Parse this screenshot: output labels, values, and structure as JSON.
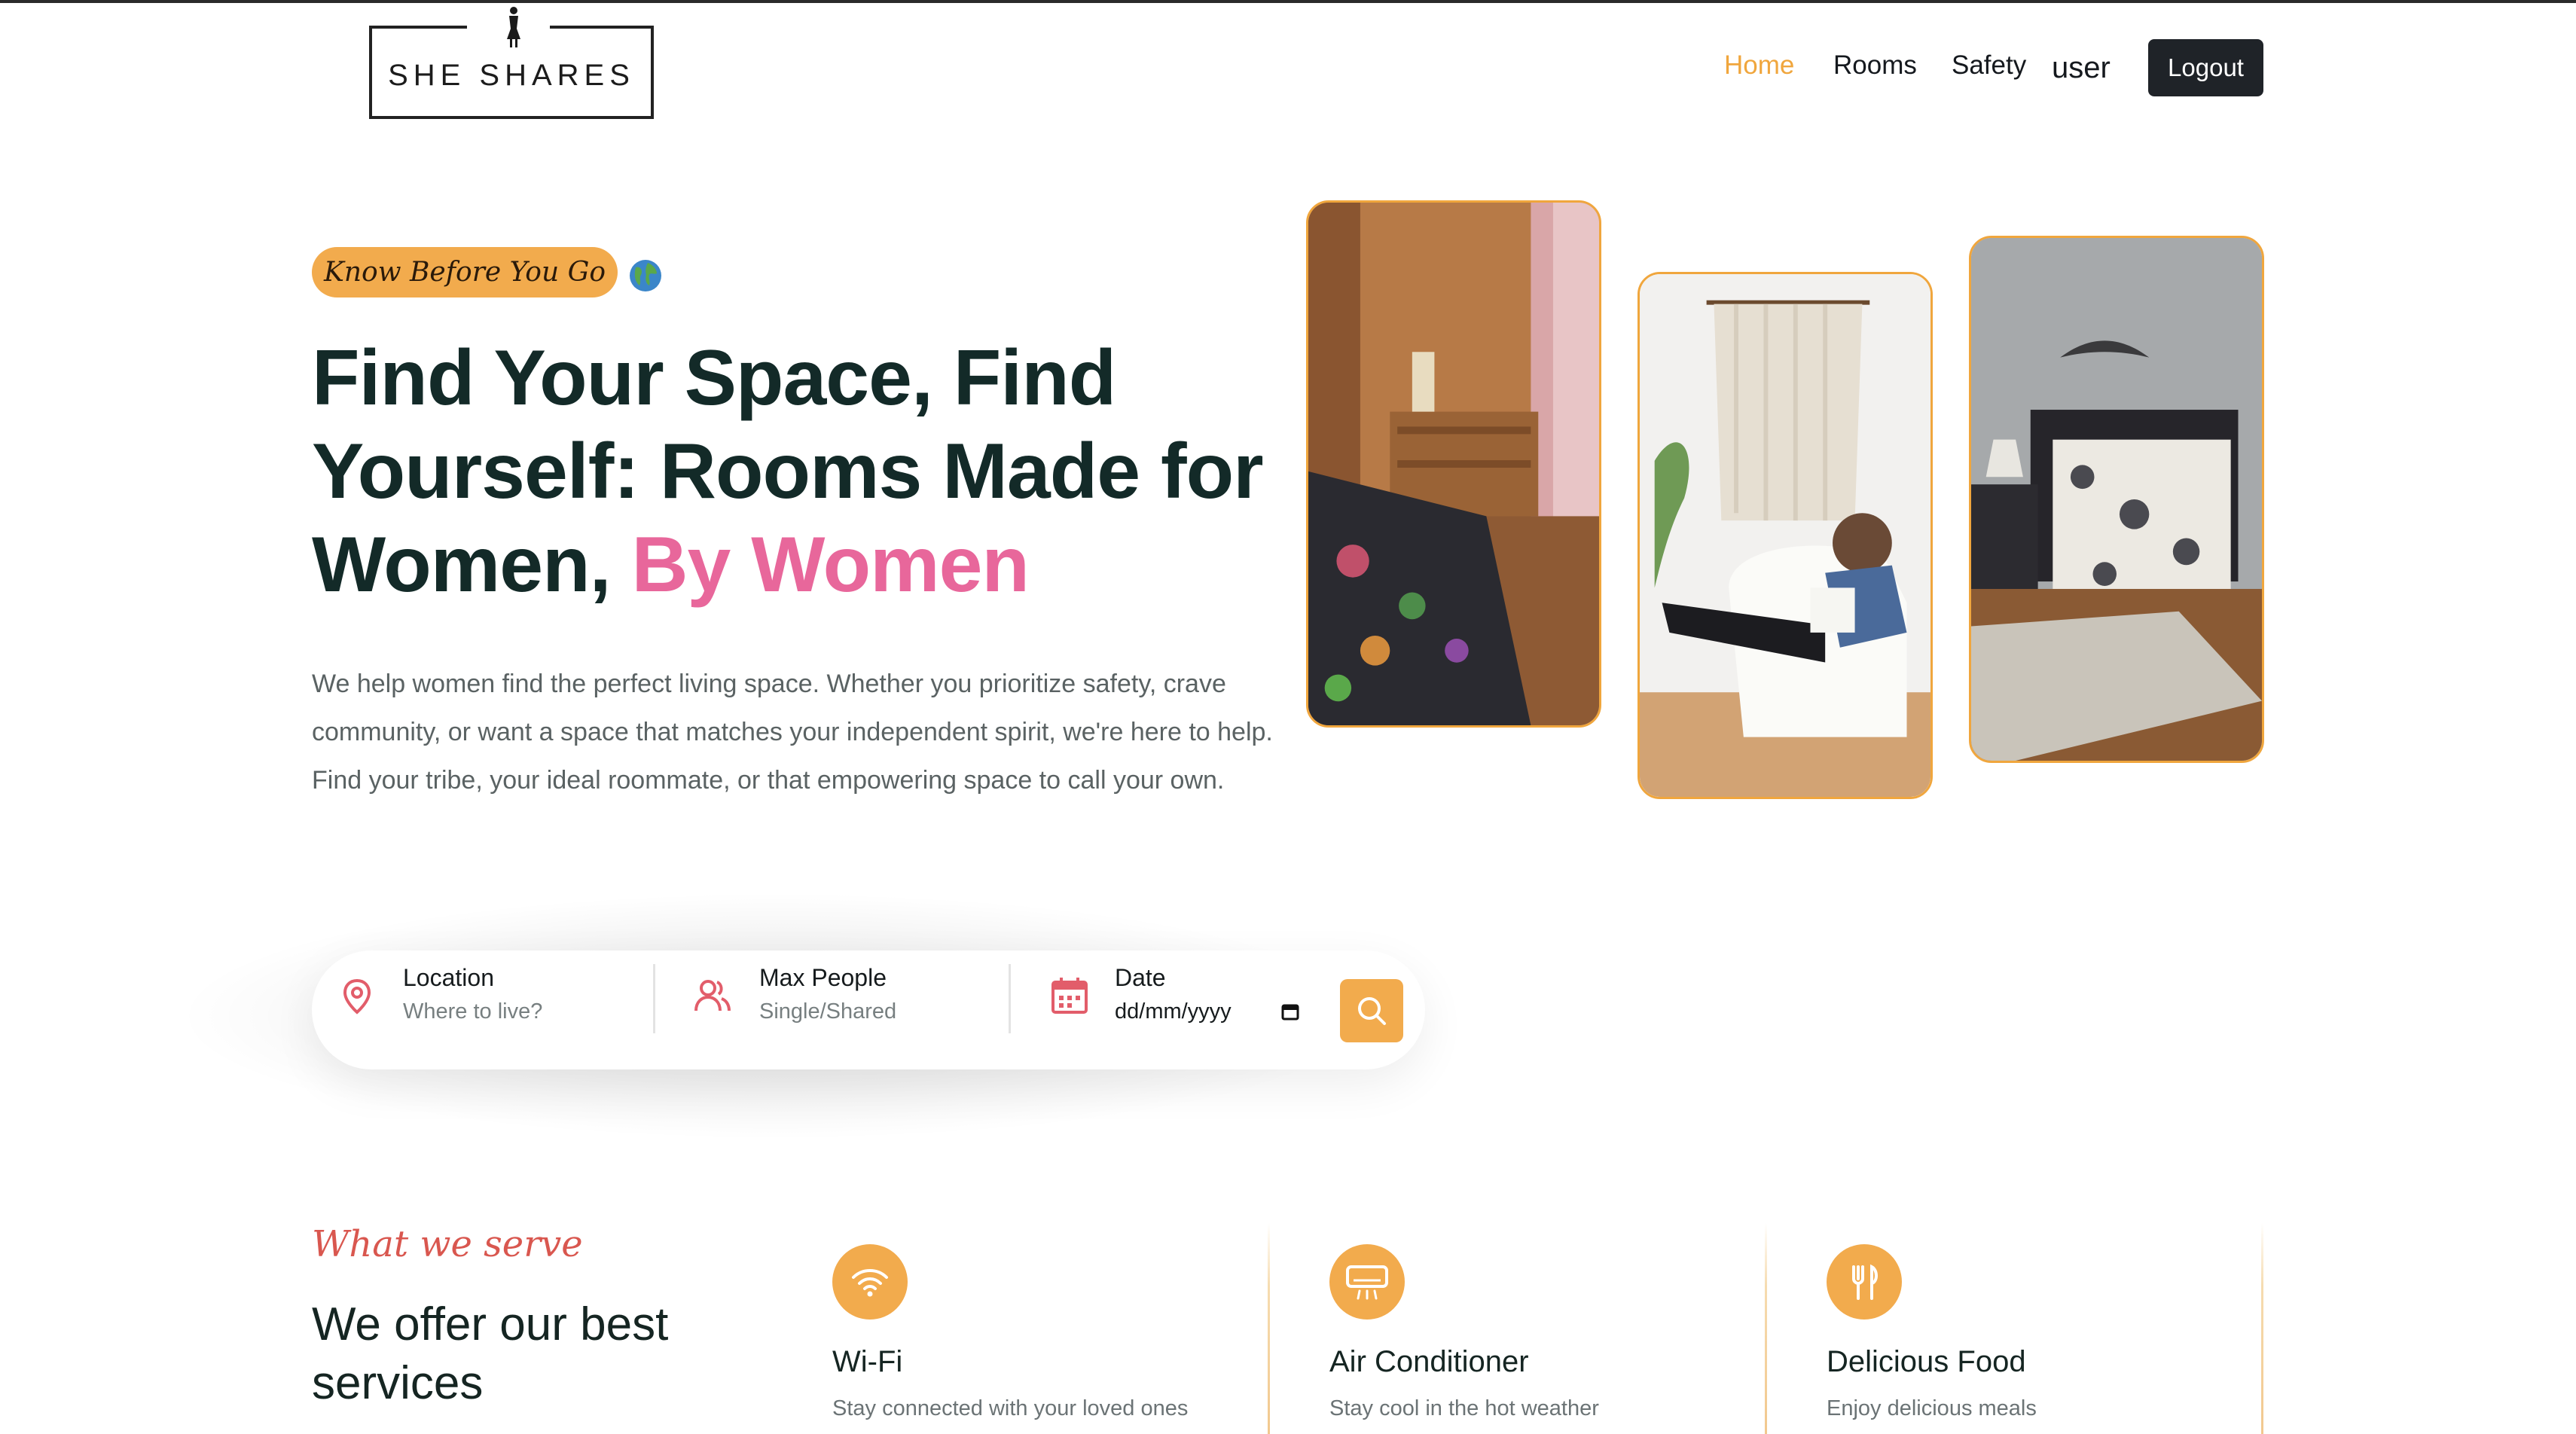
{
  "header": {
    "logo_text": "SHE SHARES",
    "nav": [
      {
        "label": "Home",
        "active": true
      },
      {
        "label": "Rooms",
        "active": false
      },
      {
        "label": "Safety",
        "active": false
      }
    ],
    "user_label": "user",
    "logout_label": "Logout"
  },
  "hero": {
    "tagline": "Know Before You Go",
    "title_part1": "Find Your Space, Find Yourself: Rooms Made for Women,",
    "title_highlight": "By Women",
    "description": "We help women find the perfect living space. Whether you prioritize safety, crave community, or want a space that matches your independent spirit, we're here to help. Find your tribe, your ideal roommate, or that empowering space to call your own."
  },
  "search": {
    "location_label": "Location",
    "location_placeholder": "Where to live?",
    "people_label": "Max People",
    "people_placeholder": "Single/Shared",
    "date_label": "Date",
    "date_placeholder": "dd/mm/yyyy"
  },
  "services": {
    "eyebrow": "What we serve",
    "title": "We offer our best services",
    "items": [
      {
        "title": "Wi-Fi",
        "description": "Stay connected with your loved ones",
        "icon": "wifi-icon"
      },
      {
        "title": "Air Conditioner",
        "description": "Stay cool in the hot weather",
        "icon": "air-conditioner-icon"
      },
      {
        "title": "Delicious Food",
        "description": "Enjoy delicious meals",
        "icon": "fork-knife-icon"
      }
    ]
  },
  "colors": {
    "accent": "#f0a63d",
    "highlight_pink": "#e8679b",
    "script_red": "#d9574f",
    "dark": "#1f2328"
  }
}
